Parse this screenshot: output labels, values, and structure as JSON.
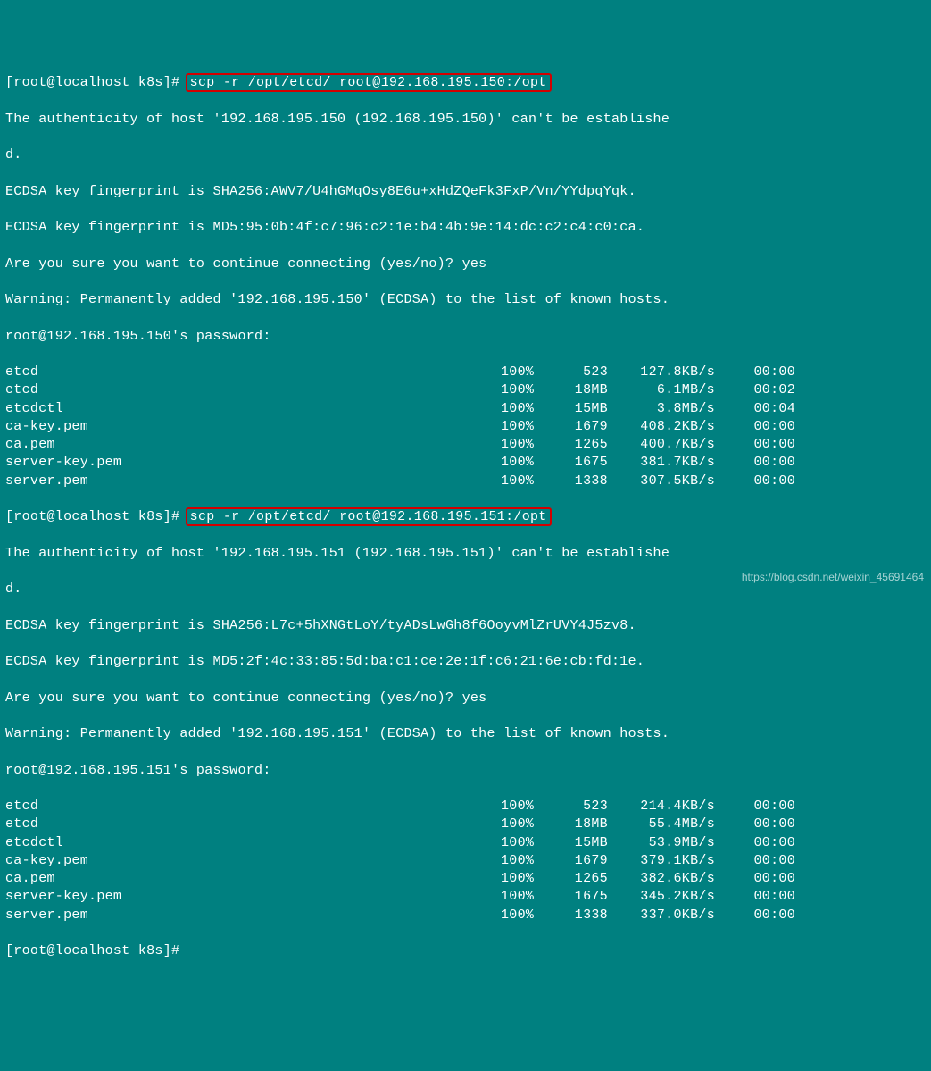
{
  "prompt1": {
    "text": "[root@localhost k8s]# ",
    "cmd": "scp -r /opt/etcd/ root@192.168.195.150:/opt"
  },
  "block1": {
    "auth1": "The authenticity of host '192.168.195.150 (192.168.195.150)' can't be establishe",
    "auth2": "d.",
    "fp1": "ECDSA key fingerprint is SHA256:AWV7/U4hGMqOsy8E6u+xHdZQeFk3FxP/Vn/YYdpqYqk.",
    "fp2": "ECDSA key fingerprint is MD5:95:0b:4f:c7:96:c2:1e:b4:4b:9e:14:dc:c2:c4:c0:ca.",
    "cont": "Are you sure you want to continue connecting (yes/no)? yes",
    "warn": "Warning: Permanently added '192.168.195.150' (ECDSA) to the list of known hosts.",
    "pw": "root@192.168.195.150's password:"
  },
  "transfers1": [
    {
      "name": "etcd",
      "pct": "100%",
      "size": "523",
      "speed": "127.8KB/s",
      "time": "00:00"
    },
    {
      "name": "etcd",
      "pct": "100%",
      "size": "18MB",
      "speed": "6.1MB/s",
      "time": "00:02"
    },
    {
      "name": "etcdctl",
      "pct": "100%",
      "size": "15MB",
      "speed": "3.8MB/s",
      "time": "00:04"
    },
    {
      "name": "ca-key.pem",
      "pct": "100%",
      "size": "1679",
      "speed": "408.2KB/s",
      "time": "00:00"
    },
    {
      "name": "ca.pem",
      "pct": "100%",
      "size": "1265",
      "speed": "400.7KB/s",
      "time": "00:00"
    },
    {
      "name": "server-key.pem",
      "pct": "100%",
      "size": "1675",
      "speed": "381.7KB/s",
      "time": "00:00"
    },
    {
      "name": "server.pem",
      "pct": "100%",
      "size": "1338",
      "speed": "307.5KB/s",
      "time": "00:00"
    }
  ],
  "prompt2": {
    "text": "[root@localhost k8s]# ",
    "cmd": "scp -r /opt/etcd/ root@192.168.195.151:/opt"
  },
  "block2": {
    "auth1": "The authenticity of host '192.168.195.151 (192.168.195.151)' can't be establishe",
    "auth2": "d.",
    "fp1": "ECDSA key fingerprint is SHA256:L7c+5hXNGtLoY/tyADsLwGh8f6OoyvMlZrUVY4J5zv8.",
    "fp2": "ECDSA key fingerprint is MD5:2f:4c:33:85:5d:ba:c1:ce:2e:1f:c6:21:6e:cb:fd:1e.",
    "cont": "Are you sure you want to continue connecting (yes/no)? yes",
    "warn": "Warning: Permanently added '192.168.195.151' (ECDSA) to the list of known hosts.",
    "pw": "root@192.168.195.151's password:"
  },
  "transfers2": [
    {
      "name": "etcd",
      "pct": "100%",
      "size": "523",
      "speed": "214.4KB/s",
      "time": "00:00"
    },
    {
      "name": "etcd",
      "pct": "100%",
      "size": "18MB",
      "speed": "55.4MB/s",
      "time": "00:00"
    },
    {
      "name": "etcdctl",
      "pct": "100%",
      "size": "15MB",
      "speed": "53.9MB/s",
      "time": "00:00"
    },
    {
      "name": "ca-key.pem",
      "pct": "100%",
      "size": "1679",
      "speed": "379.1KB/s",
      "time": "00:00"
    },
    {
      "name": "ca.pem",
      "pct": "100%",
      "size": "1265",
      "speed": "382.6KB/s",
      "time": "00:00"
    },
    {
      "name": "server-key.pem",
      "pct": "100%",
      "size": "1675",
      "speed": "345.2KB/s",
      "time": "00:00"
    },
    {
      "name": "server.pem",
      "pct": "100%",
      "size": "1338",
      "speed": "337.0KB/s",
      "time": "00:00"
    }
  ],
  "prompt3": "[root@localhost k8s]#",
  "watermark": "https://blog.csdn.net/weixin_45691464"
}
